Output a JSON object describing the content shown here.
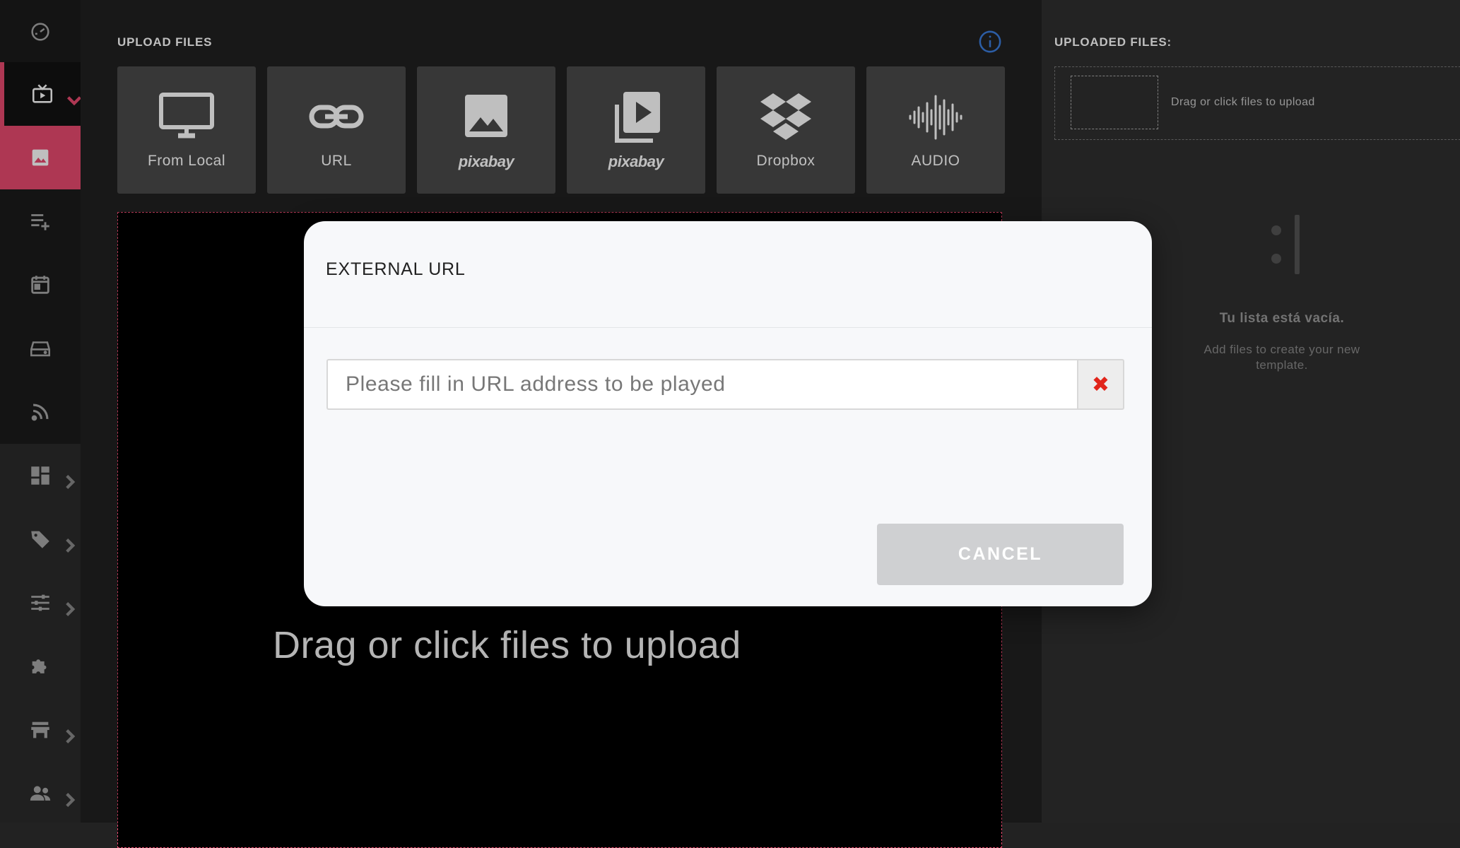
{
  "main": {
    "section_title": "UPLOAD FILES",
    "tiles": [
      {
        "label": "From Local",
        "icon": "monitor-icon"
      },
      {
        "label": "URL",
        "icon": "link-icon"
      },
      {
        "label": "pixabay",
        "icon": "image-icon"
      },
      {
        "label": "pixabay",
        "icon": "video-library-icon"
      },
      {
        "label": "Dropbox",
        "icon": "dropbox-icon"
      },
      {
        "label": "AUDIO",
        "icon": "audio-wave-icon"
      }
    ],
    "drop_text": "Drag or click files to upload"
  },
  "right_panel": {
    "title": "UPLOADED FILES:",
    "drop_text": "Drag or click files to upload",
    "empty_title": "Tu lista está vacía.",
    "empty_subtitle": "Add files to create your new template."
  },
  "modal": {
    "title": "EXTERNAL URL",
    "url_value": "",
    "url_placeholder": "Please fill in URL address to be played",
    "clear_symbol": "✖",
    "cancel_label": "CANCEL"
  },
  "colors": {
    "accent": "#e84a6f",
    "info": "#3b7ddd",
    "clear": "#e1251b"
  }
}
